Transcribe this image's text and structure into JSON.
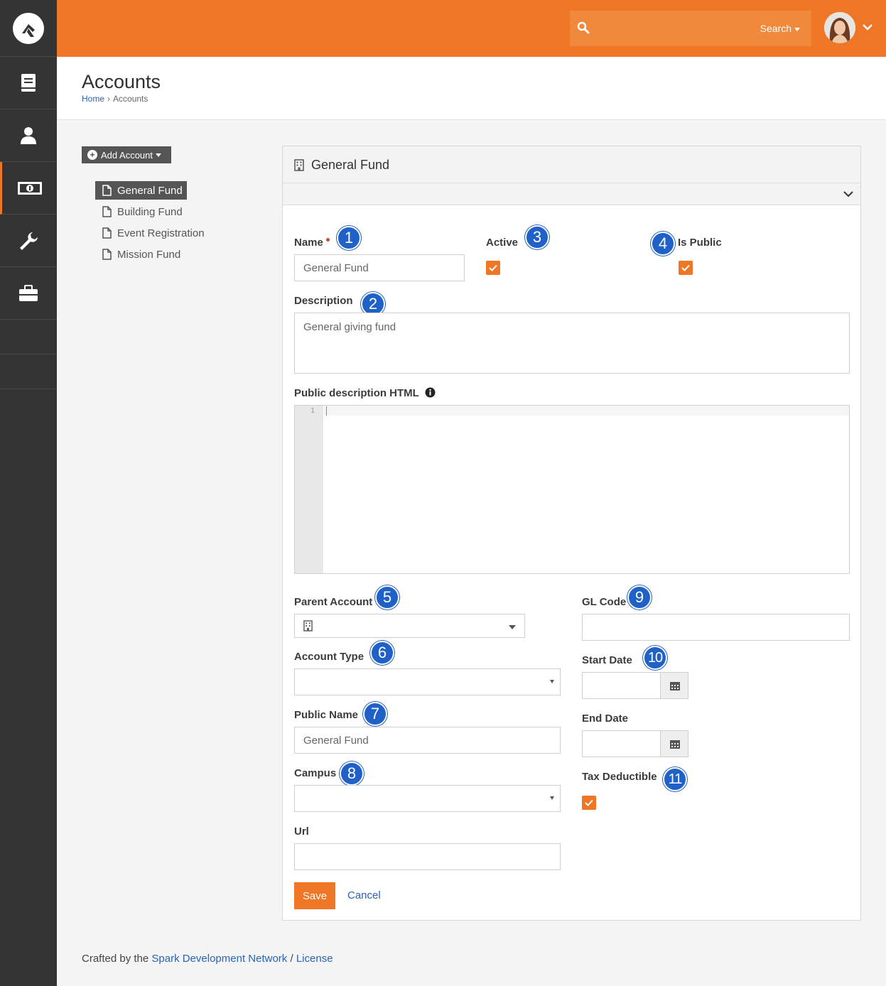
{
  "topbar": {
    "search_label": "Search",
    "icons": [
      "rock-logo-icon",
      "search-icon",
      "chevron-down-icon"
    ],
    "accent_color": "#ee7624"
  },
  "sidebar": {
    "items": [
      {
        "name": "book-icon"
      },
      {
        "name": "person-icon"
      },
      {
        "name": "money-icon",
        "active": true
      },
      {
        "name": "wrench-icon"
      },
      {
        "name": "briefcase-icon"
      }
    ]
  },
  "header": {
    "title": "Accounts",
    "breadcrumb": [
      "Home",
      "Accounts"
    ]
  },
  "tree": {
    "add_button": "Add Account",
    "items": [
      "General Fund",
      "Building Fund",
      "Event Registration",
      "Mission Fund"
    ],
    "selected_index": 0
  },
  "panel": {
    "title": "General Fund",
    "fields": {
      "name_label": "Name",
      "name_value": "General Fund",
      "active_label": "Active",
      "active_checked": true,
      "is_public_label": "Is Public",
      "is_public_checked": true,
      "description_label": "Description",
      "description_value": "General giving fund",
      "public_html_label": "Public description HTML",
      "editor_line": "1",
      "parent_account_label": "Parent Account",
      "gl_code_label": "GL Code",
      "account_type_label": "Account Type",
      "start_date_label": "Start Date",
      "public_name_label": "Public Name",
      "public_name_value": "General Fund",
      "end_date_label": "End Date",
      "campus_label": "Campus",
      "tax_deductible_label": "Tax Deductible",
      "tax_deductible_checked": true,
      "url_label": "Url"
    },
    "badges": [
      "1",
      "2",
      "3",
      "4",
      "5",
      "6",
      "7",
      "8",
      "9",
      "10",
      "11"
    ],
    "save_label": "Save",
    "cancel_label": "Cancel"
  },
  "footer": {
    "prefix": "Crafted by the",
    "link1": "Spark Development Network",
    "sep": "/",
    "link2": "License"
  }
}
